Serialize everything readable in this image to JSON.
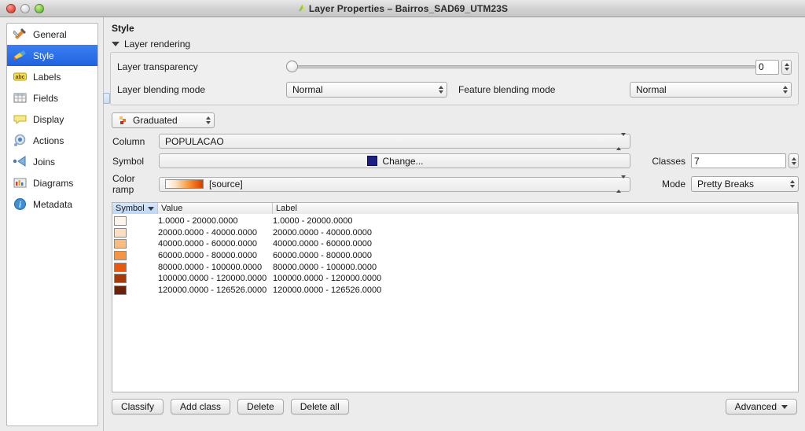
{
  "window": {
    "title": "Layer Properties – Bairros_SAD69_UTM23S",
    "title_icon": "qgis-layer-icon",
    "controls": {
      "close": "close-button",
      "minimize": "minimize-button",
      "zoom": "zoom-button"
    }
  },
  "sidebar": {
    "items": [
      {
        "label": "General",
        "icon": "hammer-wrench-icon",
        "selected": false
      },
      {
        "label": "Style",
        "icon": "paintbrush-icon",
        "selected": true
      },
      {
        "label": "Labels",
        "icon": "abc-label-icon",
        "selected": false
      },
      {
        "label": "Fields",
        "icon": "table-grid-icon",
        "selected": false
      },
      {
        "label": "Display",
        "icon": "speech-bubble-icon",
        "selected": false
      },
      {
        "label": "Actions",
        "icon": "gear-cog-icon",
        "selected": false
      },
      {
        "label": "Joins",
        "icon": "join-arrow-icon",
        "selected": false
      },
      {
        "label": "Diagrams",
        "icon": "bar-chart-icon",
        "selected": false
      },
      {
        "label": "Metadata",
        "icon": "info-circle-icon",
        "selected": false
      }
    ]
  },
  "main": {
    "page_title": "Style",
    "layer_rendering": {
      "group_label": "Layer rendering",
      "transparency_label": "Layer transparency",
      "transparency_value": "0",
      "transparency_percent": 0,
      "layer_blending_label": "Layer blending mode",
      "layer_blending_value": "Normal",
      "feature_blending_label": "Feature blending mode",
      "feature_blending_value": "Normal"
    },
    "renderer": {
      "value": "Graduated",
      "icon": "graduated-renderer-icon"
    },
    "column_label": "Column",
    "column_value": "POPULACAO",
    "symbol_label": "Symbol",
    "symbol_change_label": "Change...",
    "symbol_color": "#1d1d83",
    "color_ramp_label": "Color ramp",
    "color_ramp_value": "[source]",
    "classes_label": "Classes",
    "classes_value": "7",
    "mode_label": "Mode",
    "mode_value": "Pretty Breaks",
    "table": {
      "headers": {
        "symbol": "Symbol",
        "value": "Value",
        "label": "Label"
      },
      "sorted_by": "Symbol",
      "rows": [
        {
          "color": "#fdf4ec",
          "value": "1.0000 - 20000.0000",
          "label": "1.0000 - 20000.0000"
        },
        {
          "color": "#fbdfc3",
          "value": "20000.0000 - 40000.0000",
          "label": "20000.0000 - 40000.0000"
        },
        {
          "color": "#f7bd80",
          "value": "40000.0000 - 60000.0000",
          "label": "40000.0000 - 60000.0000"
        },
        {
          "color": "#f59442",
          "value": "60000.0000 - 80000.0000",
          "label": "60000.0000 - 80000.0000"
        },
        {
          "color": "#e8590c",
          "value": "80000.0000 - 100000.0000",
          "label": "80000.0000 - 100000.0000"
        },
        {
          "color": "#a63a06",
          "value": "100000.0000 - 120000.0000",
          "label": "100000.0000 - 120000.0000"
        },
        {
          "color": "#6b2208",
          "value": "120000.0000 - 126526.0000",
          "label": "120000.0000 - 126526.0000"
        }
      ]
    },
    "buttons": {
      "classify": "Classify",
      "add_class": "Add class",
      "delete": "Delete",
      "delete_all": "Delete all",
      "advanced": "Advanced"
    }
  }
}
